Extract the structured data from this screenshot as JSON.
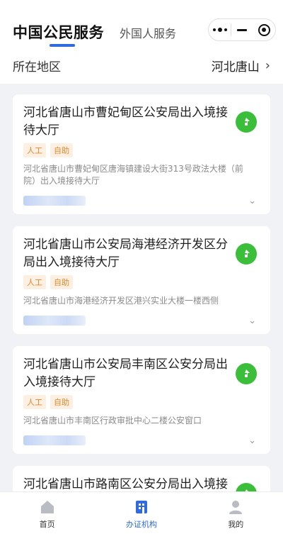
{
  "header": {
    "tab_active": "中国公民服务",
    "tab_inactive": "外国人服务"
  },
  "region": {
    "label": "所在地区",
    "value": "河北唐山"
  },
  "offices": [
    {
      "title": "河北省唐山市曹妃甸区公安局出入境接待大厅",
      "tags": [
        "人工",
        "自助"
      ],
      "address": "河北省唐山市曹妃甸区唐海镇建设大街313号政法大楼（前院）出入境接待大厅"
    },
    {
      "title": "河北省唐山市公安局海港经济开发区分局出入境接待大厅",
      "tags": [
        "人工",
        "自助"
      ],
      "address": "河北省唐山市海港经济开发区港兴实业大楼一楼西侧"
    },
    {
      "title": "河北省唐山市公安局丰南区公安分局出入境接待大厅",
      "tags": [
        "人工",
        "自助"
      ],
      "address": "河北省唐山市丰南区行政审批中心二楼公安窗口"
    },
    {
      "title": "河北省唐山市路南区公安分局出入境接待大厅",
      "tags": [],
      "address": ""
    }
  ],
  "tabbar": [
    {
      "label": "首页",
      "icon": "home-icon",
      "active": false
    },
    {
      "label": "办证机构",
      "icon": "building-icon",
      "active": true
    },
    {
      "label": "我的",
      "icon": "user-icon",
      "active": false
    }
  ],
  "colors": {
    "accent": "#2f6bdf",
    "nav_green": "#3bbf3b",
    "tag_text": "#e28a2f",
    "tag_bg": "#fdf0e2"
  }
}
